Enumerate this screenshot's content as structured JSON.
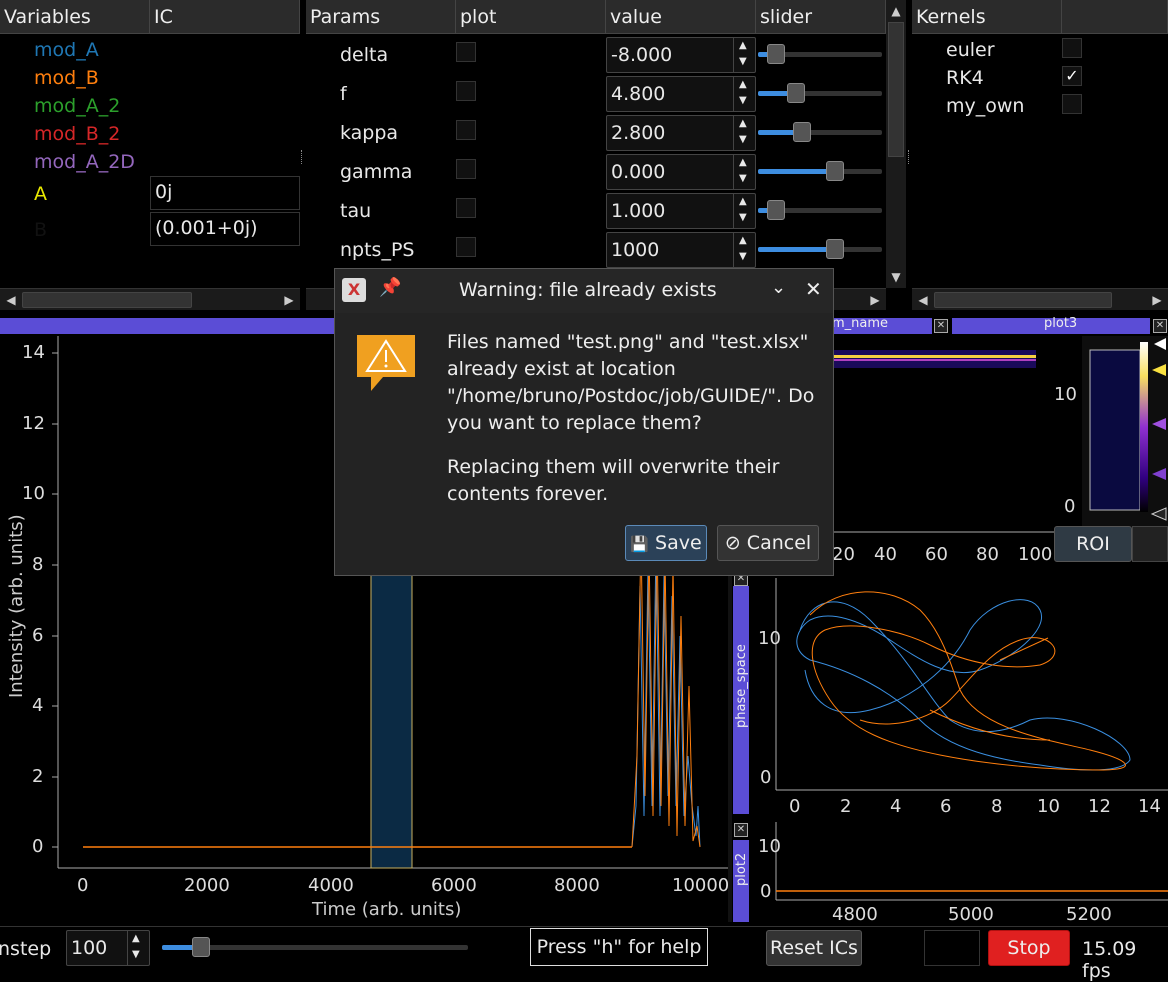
{
  "variables_panel": {
    "headers": [
      "Variables",
      "IC"
    ],
    "rows": [
      {
        "name": "mod_A",
        "color": "#1f77b4",
        "ic": ""
      },
      {
        "name": "mod_B",
        "color": "#ff7f0e",
        "ic": ""
      },
      {
        "name": "mod_A_2",
        "color": "#2ca02c",
        "ic": ""
      },
      {
        "name": "mod_B_2",
        "color": "#d62728",
        "ic": ""
      },
      {
        "name": "mod_A_2D",
        "color": "#9467bd",
        "ic": ""
      },
      {
        "name": "A",
        "color": "#e8e800",
        "ic": "0j"
      },
      {
        "name": "B",
        "color": "#111111",
        "ic": "(0.001+0j)"
      }
    ]
  },
  "params_panel": {
    "headers": [
      "Params",
      "plot",
      "value",
      "slider"
    ],
    "rows": [
      {
        "name": "delta",
        "value": "-8.000",
        "slider_fraction": 0.12
      },
      {
        "name": "f",
        "value": "4.800",
        "slider_fraction": 0.28
      },
      {
        "name": "kappa",
        "value": "2.800",
        "slider_fraction": 0.33
      },
      {
        "name": "gamma",
        "value": "0.000",
        "slider_fraction": 0.6
      },
      {
        "name": "tau",
        "value": "1.000",
        "slider_fraction": 0.12
      },
      {
        "name": "npts_PS",
        "value": "1000",
        "slider_fraction": 0.6
      }
    ]
  },
  "kernels_panel": {
    "headers": [
      "Kernels",
      ""
    ],
    "rows": [
      {
        "name": "euler",
        "checked": false,
        "check_mark": ""
      },
      {
        "name": "RK4",
        "checked": true,
        "check_mark": "✓"
      },
      {
        "name": "my_own",
        "checked": false,
        "check_mark": ""
      }
    ]
  },
  "dock_tabs": {
    "tab_partial": "m_name",
    "tab_plot3": "plot3",
    "tab_phase_space": "phase_space",
    "tab_plot2": "plot2"
  },
  "main_plot": {
    "xlabel": "Time (arb. units)",
    "ylabel": "Intensity (arb. units)",
    "xticks": [
      "0",
      "2000",
      "4000",
      "6000",
      "8000",
      "10000"
    ],
    "yticks": [
      "0",
      "2",
      "4",
      "6",
      "8",
      "10",
      "12",
      "14"
    ]
  },
  "plot3": {
    "xticks": [
      "20",
      "40",
      "60",
      "80",
      "100"
    ],
    "colorbar_ticks": [
      "10",
      "0"
    ],
    "roi_label": "ROI"
  },
  "phase_space": {
    "xticks": [
      "0",
      "2",
      "4",
      "6",
      "8",
      "10",
      "12",
      "14"
    ],
    "yticks": [
      "10",
      "0"
    ]
  },
  "plot2": {
    "xticks": [
      "4800",
      "5000",
      "5200"
    ],
    "yticks": [
      "10",
      "0"
    ]
  },
  "bottom_bar": {
    "nstep_label": "nstep",
    "nstep_value": "100",
    "help_text": "Press \"h\" for help",
    "reset_label": "Reset ICs",
    "stop_label": "Stop",
    "fps_text": "15.09 fps",
    "colors": {
      "stop_bg": "#e02020"
    }
  },
  "dialog": {
    "title": "Warning: file already exists",
    "message1": "Files named \"test.png\" and \"test.xlsx\" already exist at location \"/home/bruno/Postdoc/job/GUIDE/\". Do you want to replace them?",
    "message2": "Replacing them will overwrite their contents forever.",
    "save_label": "Save",
    "cancel_label": "Cancel"
  },
  "colors": {
    "series_a": "#3a8fe0",
    "series_b": "#ff7f0e",
    "accent": "#5b4dd6"
  }
}
